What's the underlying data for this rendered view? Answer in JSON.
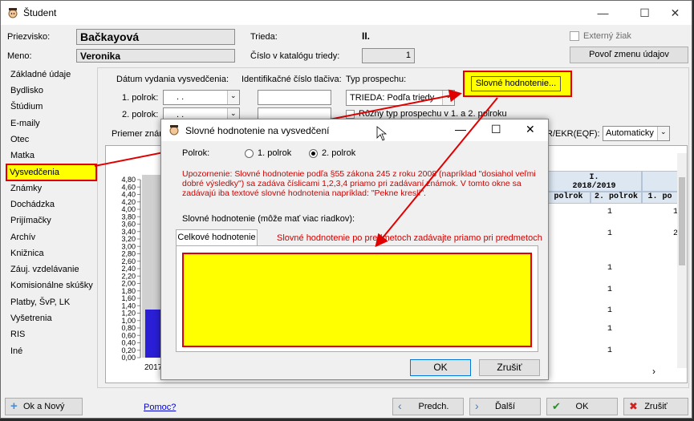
{
  "window": {
    "title": "Študent",
    "minimize": "—",
    "maximize": "☐",
    "close": "✕"
  },
  "header": {
    "surname_label": "Priezvisko:",
    "surname_value": "Bačkayová",
    "name_label": "Meno:",
    "name_value": "Veronika",
    "class_label": "Trieda:",
    "class_value": "II.",
    "catalog_label": "Číslo v katalógu triedy:",
    "catalog_value": "1",
    "external_label": "Externý žiak",
    "allow_edit_label": "Povoľ zmenu údajov"
  },
  "sidebar": {
    "items": [
      "Základné údaje",
      "Bydlisko",
      "Štúdium",
      "E-maily",
      "Otec",
      "Matka",
      "Vysvedčenia",
      "Známky",
      "Dochádzka",
      "Prijímačky",
      "Archív",
      "Knižnica",
      "Záuj. vzdelávanie",
      "Komisionálne skúšky",
      "Platby, ŠvP, LK",
      "Vyšetrenia",
      "RIS",
      "Iné"
    ],
    "selected": "Vysvedčenia"
  },
  "certificates": {
    "issue_date_label": "Dátum vydania vysvedčenia:",
    "sem1_label": "1. polrok:",
    "sem2_label": "2. polrok:",
    "date_placeholder": " .   . ",
    "id_label": "Identifikačné číslo tlačiva:",
    "type_label": "Typ prospechu:",
    "type_value": "TRIEDA: Podľa triedy",
    "different_type_label": "Rôzny typ prospechu v 1. a 2. polroku",
    "verbal_button": "Slovné hodnotenie...",
    "average_label": "Priemer znám",
    "ekr_label": "R/EKR(EQF):",
    "ekr_value": "Automaticky"
  },
  "chart": {
    "ticks": [
      "4,80",
      "4,60",
      "4,40",
      "4,20",
      "4,00",
      "3,80",
      "3,60",
      "3,40",
      "3,20",
      "3,00",
      "2,80",
      "2,60",
      "2,40",
      "2,20",
      "2,00",
      "1,80",
      "1,60",
      "1,40",
      "1,20",
      "1,00",
      "0,80",
      "0,60",
      "0,40",
      "0,20",
      "0,00"
    ],
    "x_label": "2017"
  },
  "grid": {
    "year_label": "I.",
    "year_value": "2018/2019",
    "col_sem1": "polrok",
    "col_sem2": "2. polrok",
    "col_sem1_next": "1. po",
    "values": [
      "1",
      "1",
      "1",
      "1",
      "1",
      "1",
      "1",
      "1"
    ],
    "edge_values": [
      "1",
      "2"
    ]
  },
  "dialog": {
    "title": "Slovné hodnotenie na vysvedčení",
    "semester_label": "Polrok:",
    "sem1_option": "1. polrok",
    "sem2_option": "2. polrok",
    "warning": "Upozornenie: Slovné hodnotenie podľa §55 zákona 245 z roku 2008 (napríklad \"dosiahol veľmi dobré výsledky\") sa zadáva číslicami 1,2,3,4 priamo pri zadávaní známok. V tomto okne sa zadávajú iba textové slovné hodnotenia napríklad: \"Pekne kreslí\".",
    "text_label": "Slovné hodnotenie (môže mať viac riadkov):",
    "tab_overall": "Celkové hodnotenie",
    "tab_note": "Slovné hodnotenie po predmetoch zadávajte priamo pri predmetoch",
    "ok": "OK",
    "cancel": "Zrušiť"
  },
  "footer": {
    "ok_new": "Ok a Nový",
    "help": "Pomoc?",
    "prev": "Predch.",
    "next": "Ďalší",
    "ok": "OK",
    "cancel": "Zrušiť"
  },
  "colors": {
    "highlight": "#ffff00",
    "annotation": "#e00000",
    "bar": "#2a1fd6"
  }
}
